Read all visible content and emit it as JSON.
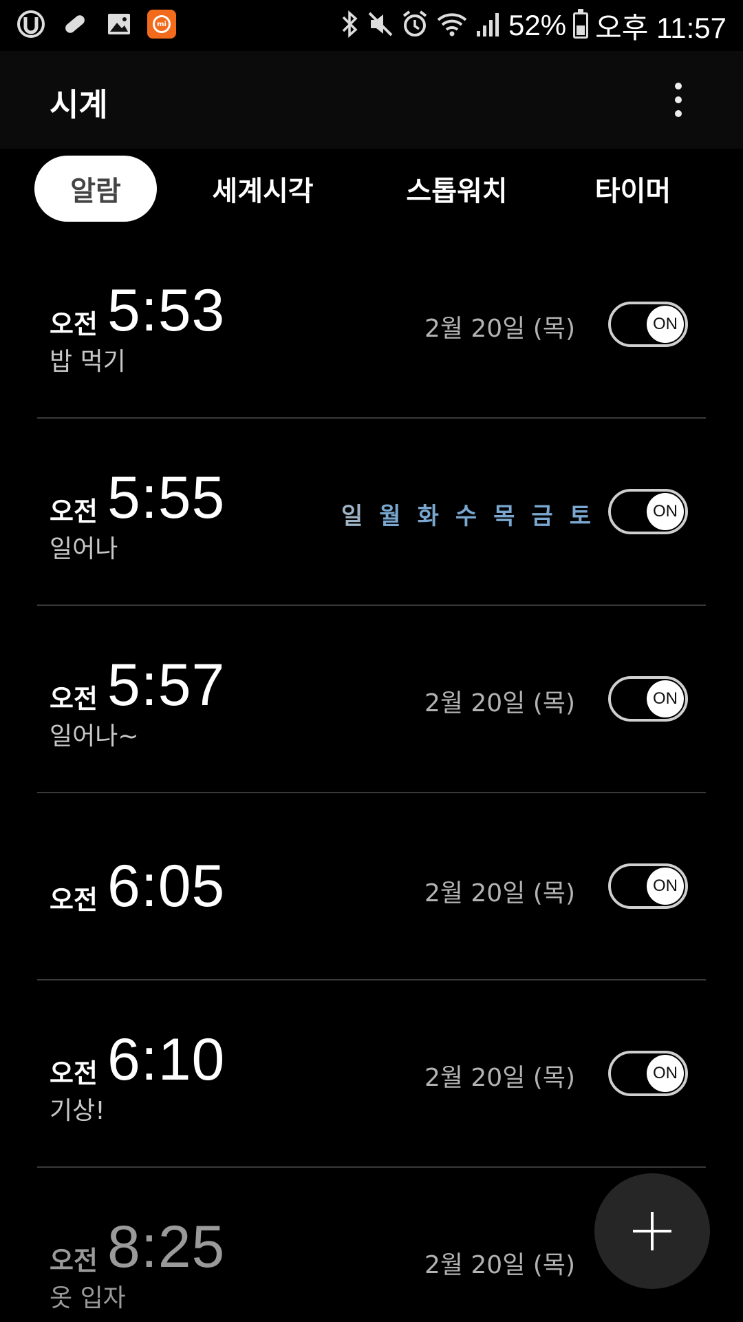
{
  "status_bar": {
    "left_icons": [
      "u-app-icon",
      "pill-icon",
      "image-icon",
      "mi-icon"
    ],
    "right_icons": [
      "bluetooth-icon",
      "mute-icon",
      "alarm-icon",
      "wifi-icon",
      "signal-icon"
    ],
    "battery": "52%",
    "battery_level": 0.52,
    "time": "오후 11:57"
  },
  "app_bar": {
    "title": "시계"
  },
  "tabs": [
    {
      "label": "알람",
      "active": true
    },
    {
      "label": "세계시각",
      "active": false
    },
    {
      "label": "스톱워치",
      "active": false
    },
    {
      "label": "타이머",
      "active": false
    }
  ],
  "alarms": [
    {
      "ampm": "오전",
      "time": "5:53",
      "label": "밥 먹기",
      "date": "2월 20일 (목)",
      "toggle": "ON"
    },
    {
      "ampm": "오전",
      "time": "5:55",
      "label": "일어나",
      "days": [
        {
          "d": "일",
          "active": false
        },
        {
          "d": "월",
          "active": true
        },
        {
          "d": "화",
          "active": true
        },
        {
          "d": "수",
          "active": true
        },
        {
          "d": "목",
          "active": true
        },
        {
          "d": "금",
          "active": true
        },
        {
          "d": "토",
          "active": true
        }
      ],
      "toggle": "ON"
    },
    {
      "ampm": "오전",
      "time": "5:57",
      "label": "일어나~",
      "date": "2월 20일 (목)",
      "toggle": "ON"
    },
    {
      "ampm": "오전",
      "time": "6:05",
      "label": "",
      "date": "2월 20일 (목)",
      "toggle": "ON"
    },
    {
      "ampm": "오전",
      "time": "6:10",
      "label": "기상!",
      "date": "2월 20일 (목)",
      "toggle": "ON"
    },
    {
      "ampm": "오전",
      "time": "8:25",
      "label": "옷 입자",
      "date": "2월 20일 (목)",
      "toggle": ""
    }
  ],
  "colors": {
    "background": "#000000",
    "day_active": "#7aa7cf",
    "day_inactive": "#9fb4c6",
    "fab": "#262626"
  }
}
